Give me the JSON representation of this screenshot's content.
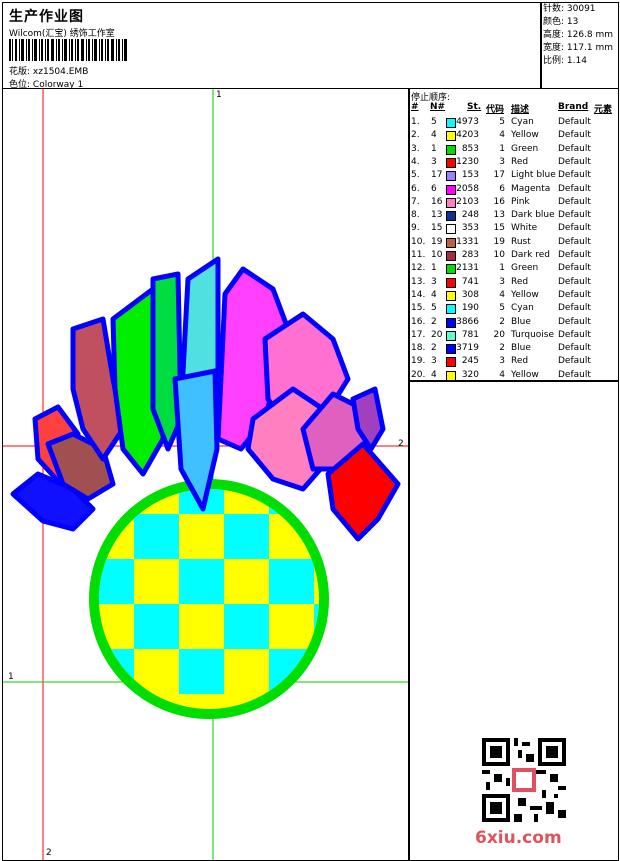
{
  "header": {
    "title": "生产作业图",
    "company": "Wilcom(汇宝) 绣饰工作室",
    "design_label": "花版:",
    "design_value": "xz1504.EMB",
    "colorway_label": "色位:",
    "colorway_value": "Colorway 1"
  },
  "stats": {
    "stitches": "针数: 30091",
    "colors": "颜色: 13",
    "height": "高度: 126.8 mm",
    "width": "宽度: 117.1 mm",
    "scale": "比例: 1.14"
  },
  "stop_sequence": {
    "title": "停止顺序:",
    "columns": [
      "#",
      "N#",
      "St.",
      "代码",
      "描述",
      "Brand",
      "元素"
    ],
    "rows": [
      {
        "idx": "1.",
        "n": "5",
        "swatch": "#00ffff",
        "st": "4973",
        "code": "5",
        "desc": "Cyan",
        "brand": "Default"
      },
      {
        "idx": "2.",
        "n": "4",
        "swatch": "#ffff00",
        "st": "4203",
        "code": "4",
        "desc": "Yellow",
        "brand": "Default"
      },
      {
        "idx": "3.",
        "n": "1",
        "swatch": "#00dd00",
        "st": "853",
        "code": "1",
        "desc": "Green",
        "brand": "Default"
      },
      {
        "idx": "4.",
        "n": "3",
        "swatch": "#ff0000",
        "st": "1230",
        "code": "3",
        "desc": "Red",
        "brand": "Default"
      },
      {
        "idx": "5.",
        "n": "17",
        "swatch": "#a080ff",
        "st": "153",
        "code": "17",
        "desc": "Light blue",
        "brand": "Default"
      },
      {
        "idx": "6.",
        "n": "6",
        "swatch": "#ff00ff",
        "st": "2058",
        "code": "6",
        "desc": "Magenta",
        "brand": "Default"
      },
      {
        "idx": "7.",
        "n": "16",
        "swatch": "#ff80c0",
        "st": "2103",
        "code": "16",
        "desc": "Pink",
        "brand": "Default"
      },
      {
        "idx": "8.",
        "n": "13",
        "swatch": "#103090",
        "st": "248",
        "code": "13",
        "desc": "Dark blue",
        "brand": "Default"
      },
      {
        "idx": "9.",
        "n": "15",
        "swatch": "#ffffff",
        "st": "353",
        "code": "15",
        "desc": "White",
        "brand": "Default"
      },
      {
        "idx": "10.",
        "n": "19",
        "swatch": "#c06040",
        "st": "1331",
        "code": "19",
        "desc": "Rust",
        "brand": "Default"
      },
      {
        "idx": "11.",
        "n": "10",
        "swatch": "#a03040",
        "st": "283",
        "code": "10",
        "desc": "Dark red",
        "brand": "Default"
      },
      {
        "idx": "12.",
        "n": "1",
        "swatch": "#00dd00",
        "st": "2131",
        "code": "1",
        "desc": "Green",
        "brand": "Default"
      },
      {
        "idx": "13.",
        "n": "3",
        "swatch": "#ff0000",
        "st": "741",
        "code": "3",
        "desc": "Red",
        "brand": "Default"
      },
      {
        "idx": "14.",
        "n": "4",
        "swatch": "#ffff00",
        "st": "308",
        "code": "4",
        "desc": "Yellow",
        "brand": "Default"
      },
      {
        "idx": "15.",
        "n": "5",
        "swatch": "#00ffff",
        "st": "190",
        "code": "5",
        "desc": "Cyan",
        "brand": "Default"
      },
      {
        "idx": "16.",
        "n": "2",
        "swatch": "#0000ff",
        "st": "3866",
        "code": "2",
        "desc": "Blue",
        "brand": "Default"
      },
      {
        "idx": "17.",
        "n": "20",
        "swatch": "#60ffd0",
        "st": "781",
        "code": "20",
        "desc": "Turquoise",
        "brand": "Default"
      },
      {
        "idx": "18.",
        "n": "2",
        "swatch": "#0000ff",
        "st": "3719",
        "code": "2",
        "desc": "Blue",
        "brand": "Default"
      },
      {
        "idx": "19.",
        "n": "3",
        "swatch": "#ff0000",
        "st": "245",
        "code": "3",
        "desc": "Red",
        "brand": "Default"
      },
      {
        "idx": "20.",
        "n": "4",
        "swatch": "#ffff00",
        "st": "320",
        "code": "4",
        "desc": "Yellow",
        "brand": "Default"
      }
    ]
  },
  "guides": {
    "top_label": "1",
    "right_label": "2",
    "left_label": "1",
    "bottom_label": "2"
  },
  "watermark": "6xiu.com"
}
